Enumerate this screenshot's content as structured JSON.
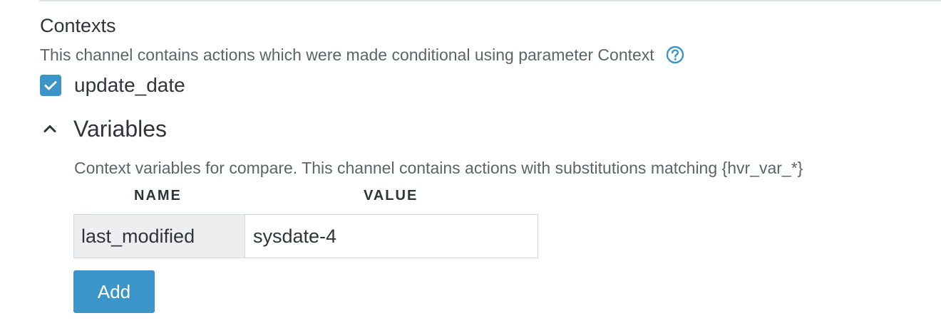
{
  "contexts": {
    "title": "Contexts",
    "description": "This channel contains actions which were made conditional using parameter Context",
    "help_icon": "question-circle-icon",
    "checkbox": {
      "label": "update_date",
      "checked": true
    }
  },
  "variables": {
    "title": "Variables",
    "expanded": true,
    "description": "Context variables for compare. This channel contains actions with substitutions matching {hvr_var_*}",
    "columns": {
      "name": "NAME",
      "value": "VALUE"
    },
    "rows": [
      {
        "name": "last_modified",
        "value": "sysdate-4"
      }
    ],
    "add_label": "Add"
  },
  "colors": {
    "accent": "#3b95c9",
    "text": "#2f3438",
    "muted_text": "#5c646a",
    "cell_bg": "#eceeef",
    "border": "#d5d9dc"
  }
}
